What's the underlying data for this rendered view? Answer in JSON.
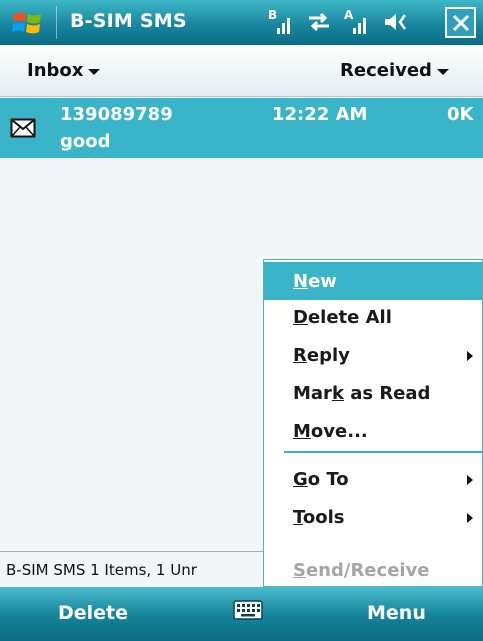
{
  "titlebar": {
    "title": "B-SIM SMS",
    "icons": [
      "windows-start-icon",
      "signal-b-icon",
      "data-arrows-icon",
      "signal-a-icon",
      "speaker-icon",
      "close-icon"
    ]
  },
  "header": {
    "folder_label": "Inbox",
    "sort_label": "Received"
  },
  "messages": [
    {
      "from": "139089789",
      "time": "12:22 AM",
      "size": "0K",
      "subject": "good",
      "icon": "envelope-icon"
    }
  ],
  "status": {
    "text": "B-SIM SMS  1 Items, 1 Unr"
  },
  "menu": {
    "items": [
      {
        "label": "New",
        "accel": "N",
        "selected": true
      },
      {
        "label": "Delete All",
        "accel": "D"
      },
      {
        "label": "Reply",
        "accel": "R",
        "submenu": true
      },
      {
        "label": "Mark as Read",
        "accel": "k"
      },
      {
        "label": "Move...",
        "accel": "M"
      },
      {
        "label": "Go To",
        "accel": "G",
        "submenu": true
      },
      {
        "label": "Tools",
        "accel": "T",
        "submenu": true
      },
      {
        "label": "Send/Receive",
        "accel": "S",
        "disabled": true
      }
    ]
  },
  "softkeys": {
    "left": "Delete",
    "right": "Menu",
    "center_icon": "keyboard-icon"
  },
  "colors": {
    "accent": "#3ab4c8",
    "bar_dark": "#0b6b85",
    "background": "#f2f6f8"
  }
}
